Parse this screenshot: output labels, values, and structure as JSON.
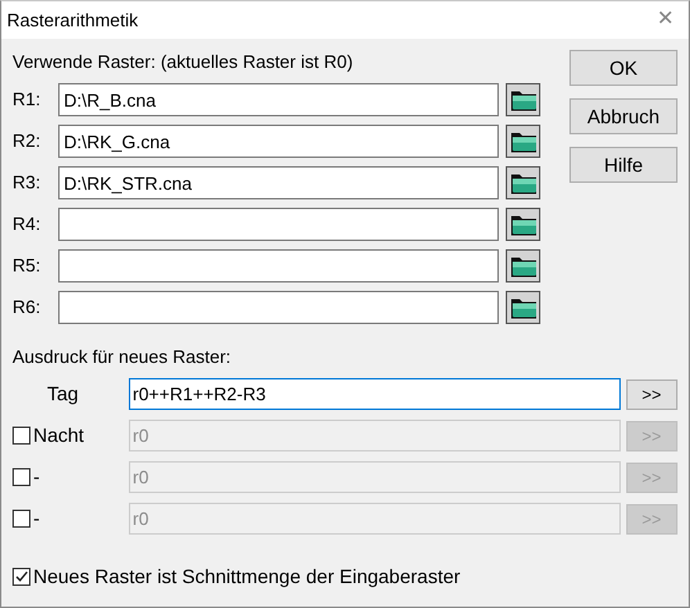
{
  "window": {
    "title": "Rasterarithmetik",
    "close": "✕"
  },
  "rasters_label": "Verwende Raster: (aktuelles Raster ist R0)",
  "rasters": [
    {
      "label": "R1:",
      "value": "D:\\R_B.cna"
    },
    {
      "label": "R2:",
      "value": "D:\\RK_G.cna"
    },
    {
      "label": "R3:",
      "value": "D:\\RK_STR.cna"
    },
    {
      "label": "R4:"
    },
    {
      "label": "R5:"
    },
    {
      "label": "R6:"
    }
  ],
  "buttons": [
    "OK",
    "Abbruch",
    "Hilfe"
  ],
  "expression_label": "Ausdruck für neues Raster:",
  "expressions": [
    {
      "kind": "label",
      "label": "Tag",
      "value": "r0++R1++R2-R3",
      "disabled": false,
      "focused": true,
      "button": ">>"
    },
    {
      "kind": "checkbox",
      "label": "Nacht",
      "checked": false,
      "value": "r0",
      "disabled": true,
      "focused": false,
      "button": ">>"
    },
    {
      "kind": "checkbox",
      "label": "-",
      "checked": false,
      "value": "r0",
      "disabled": true,
      "focused": false,
      "button": ">>"
    },
    {
      "kind": "checkbox",
      "label": "-",
      "checked": false,
      "value": "r0",
      "disabled": true,
      "focused": false,
      "button": ">>"
    }
  ],
  "intersection": {
    "label": "Neues Raster ist Schnittmenge der Eingaberaster",
    "checked": true
  }
}
